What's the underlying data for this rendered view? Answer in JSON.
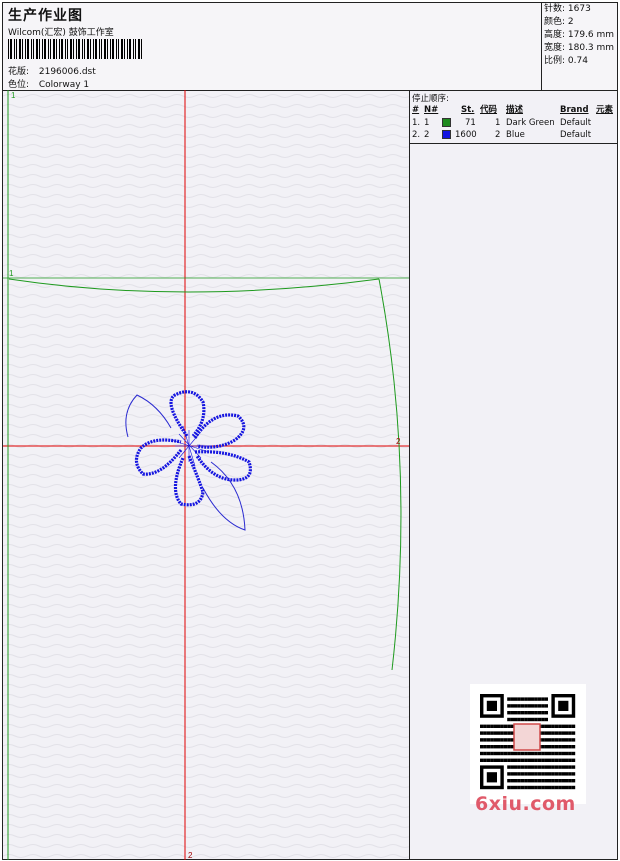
{
  "header": {
    "title": "生产作业图",
    "company": "Wilcom(汇宏) 鼓饰工作室",
    "design_label": "花版:",
    "design_value": "2196006.dst",
    "colorway_label": "色位:",
    "colorway_value": "Colorway 1"
  },
  "stats": {
    "stitches": "针数: 1673",
    "colors": "颜色: 2",
    "height": "高度: 179.6 mm",
    "width": "宽度: 180.3 mm",
    "scale": "比例: 0.74"
  },
  "stop_sequence": {
    "heading": "停止顺序:",
    "columns": {
      "num": "#",
      "n": "N#",
      "st": "St.",
      "code": "代码",
      "desc": "描述",
      "brand": "Brand",
      "element": "元素"
    },
    "rows": [
      {
        "num": "1.",
        "n": "1",
        "color": "#1e8a1e",
        "st": "71",
        "code": "1",
        "desc": "Dark Green",
        "brand": "Default"
      },
      {
        "num": "2.",
        "n": "2",
        "color": "#1515e0",
        "st": "1600",
        "code": "2",
        "desc": "Blue",
        "brand": "Default"
      }
    ]
  },
  "canvas": {
    "marker_top_left": "1",
    "marker_left": "1",
    "marker_right": "2",
    "marker_bottom": "2"
  },
  "watermark": {
    "text": "6xiu.com"
  },
  "colors": {
    "guide_red": "#e00000",
    "outline_green": "#1e9a1e",
    "flower_blue": "#1515e0"
  }
}
